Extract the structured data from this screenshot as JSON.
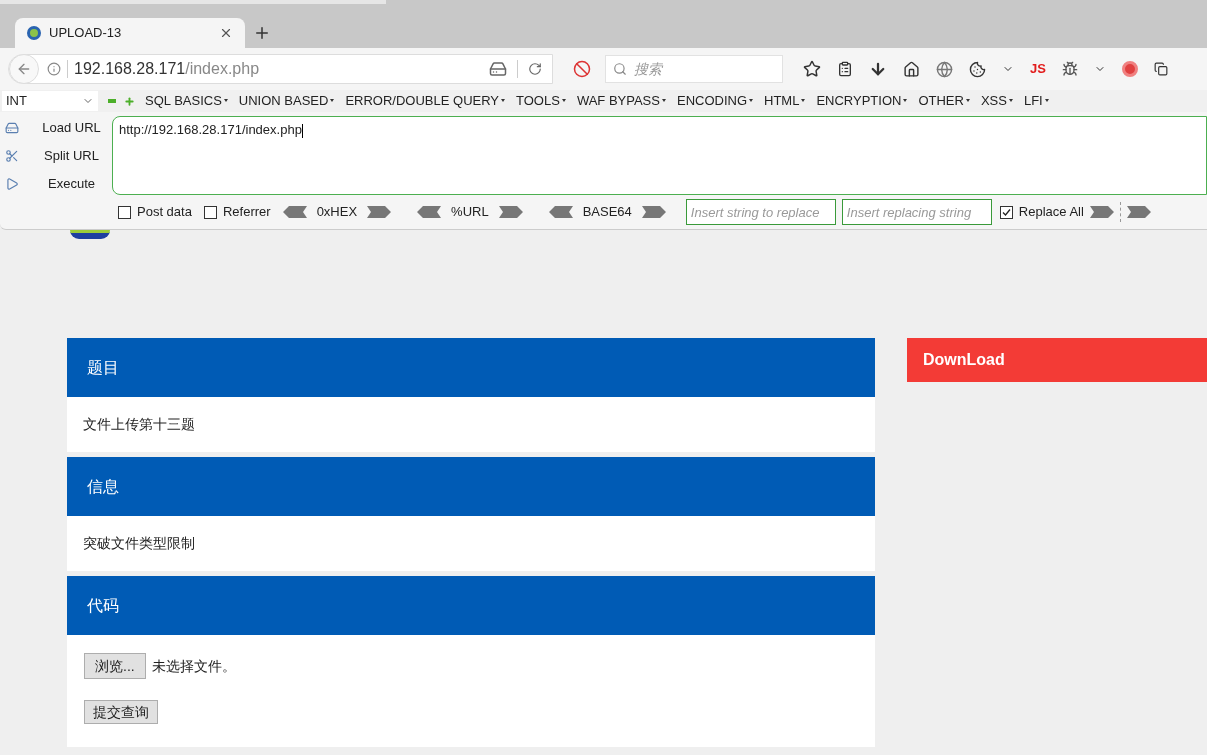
{
  "browser": {
    "tab": {
      "title": "UPLOAD-13",
      "selected": true
    },
    "address": {
      "host": "192.168.28.171",
      "path": "/index.php"
    },
    "search": {
      "placeholder": "搜索"
    },
    "toolbar_badge": "JS"
  },
  "hackbar": {
    "type_select": "INT",
    "menus": [
      "SQL BASICS",
      "UNION BASED",
      "ERROR/DOUBLE QUERY",
      "TOOLS",
      "WAF BYPASS",
      "ENCODING",
      "HTML",
      "ENCRYPTION",
      "OTHER",
      "XSS",
      "LFI"
    ],
    "actions": [
      "Load URL",
      "Split URL",
      "Execute"
    ],
    "url_value": "http://192.168.28.171/index.php",
    "options": [
      {
        "label": "Post data",
        "checked": false
      },
      {
        "label": "Referrer",
        "checked": false
      }
    ],
    "encoders": [
      "0xHEX",
      "%URL",
      "BASE64"
    ],
    "replace_from": {
      "placeholder": "Insert string to replace"
    },
    "replace_to": {
      "placeholder": "Insert replacing string"
    },
    "replace_all": {
      "label": "Replace All",
      "checked": true
    }
  },
  "page": {
    "sections": [
      {
        "heading": "题目",
        "kind": "text",
        "body": "文件上传第十三题"
      },
      {
        "heading": "信息",
        "kind": "text",
        "body": "突破文件类型限制"
      },
      {
        "heading": "代码",
        "kind": "upload",
        "browse_button": "浏览...",
        "file_status": "未选择文件。",
        "submit_button": "提交查询"
      }
    ],
    "download": {
      "title": "DownLoad"
    }
  }
}
